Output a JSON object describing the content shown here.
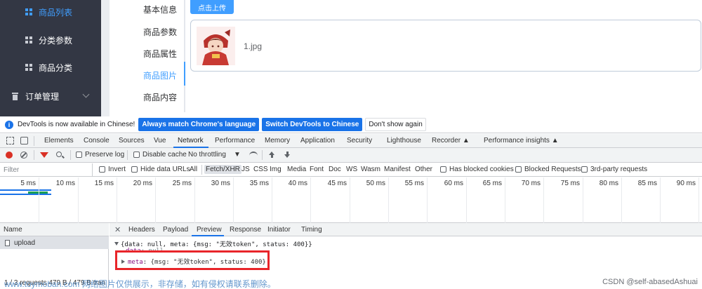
{
  "sidebar": {
    "items": [
      {
        "label": "商品列表",
        "active": true
      },
      {
        "label": "分类参数",
        "active": false
      },
      {
        "label": "商品分类",
        "active": false
      }
    ],
    "group_label": "订单管理"
  },
  "tabs": [
    "基本信息",
    "商品参数",
    "商品属性",
    "商品图片",
    "商品内容"
  ],
  "active_tab": "商品图片",
  "upload": {
    "button_label": "点击上传",
    "file_name": "1.jpg"
  },
  "devtools": {
    "infobar": {
      "text": "DevTools is now available in Chinese!",
      "btn_match": "Always match Chrome's language",
      "btn_switch": "Switch DevTools to Chinese",
      "btn_dismiss": "Don't show again"
    },
    "panels": [
      "Elements",
      "Console",
      "Sources",
      "Vue",
      "Network",
      "Performance",
      "Memory",
      "Application",
      "Security",
      "Lighthouse",
      "Recorder",
      "Performance insights"
    ],
    "active_panel": "Network",
    "toolbar": {
      "preserve_log": "Preserve log",
      "disable_cache": "Disable cache",
      "throttling": "No throttling"
    },
    "filter": {
      "placeholder": "Filter",
      "invert": "Invert",
      "hide_data_urls": "Hide data URLs",
      "types": [
        "All",
        "Fetch/XHR",
        "JS",
        "CSS",
        "Img",
        "Media",
        "Font",
        "Doc",
        "WS",
        "Wasm",
        "Manifest",
        "Other"
      ],
      "active_type": "Fetch/XHR",
      "blocked_cookies": "Has blocked cookies",
      "blocked_requests": "Blocked Requests",
      "third_party": "3rd-party requests"
    },
    "timeline_ticks": [
      "5 ms",
      "10 ms",
      "15 ms",
      "20 ms",
      "25 ms",
      "30 ms",
      "35 ms",
      "40 ms",
      "45 ms",
      "50 ms",
      "55 ms",
      "60 ms",
      "65 ms",
      "70 ms",
      "75 ms",
      "80 ms",
      "85 ms",
      "90 ms"
    ],
    "requests": {
      "header": "Name",
      "rows": [
        "upload"
      ],
      "summary": "1 / 3 requests   479 B / 479 B tran"
    },
    "detail": {
      "tabs": [
        "Headers",
        "Payload",
        "Preview",
        "Response",
        "Initiator",
        "Timing"
      ],
      "active_tab": "Preview",
      "preview": {
        "line1": "{data: null, meta: {msg: \"无效token\", status: 400}}",
        "data_key": "data",
        "data_value": "null",
        "meta_key": "meta",
        "meta_value": "{msg: \"无效token\", status: 400}"
      }
    }
  },
  "overlay": {
    "watermark": "www.toymoban.com 网络图片仅供展示，非存储，如有侵权请联系删除。",
    "credit": "CSDN @self-abasedAshuai"
  },
  "colors": {
    "sidebar_bg": "#333744",
    "accent": "#409eff",
    "devtools_blue": "#1a73e8",
    "highlight_red": "#e8252a"
  }
}
